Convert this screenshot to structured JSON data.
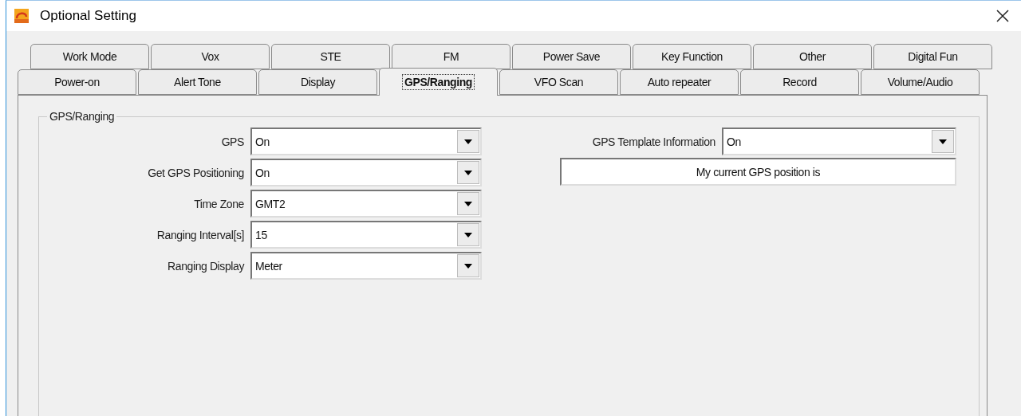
{
  "window": {
    "title": "Optional Setting"
  },
  "tab_rows": [
    [
      {
        "label": "Work Mode",
        "selected": false
      },
      {
        "label": "Vox",
        "selected": false
      },
      {
        "label": "STE",
        "selected": false
      },
      {
        "label": "FM",
        "selected": false
      },
      {
        "label": "Power Save",
        "selected": false
      },
      {
        "label": "Key Function",
        "selected": false
      },
      {
        "label": "Other",
        "selected": false
      },
      {
        "label": "Digital Fun",
        "selected": false
      }
    ],
    [
      {
        "label": "Power-on",
        "selected": false
      },
      {
        "label": "Alert Tone",
        "selected": false
      },
      {
        "label": "Display",
        "selected": false
      },
      {
        "label": "GPS/Ranging",
        "selected": true
      },
      {
        "label": "VFO Scan",
        "selected": false
      },
      {
        "label": "Auto repeater",
        "selected": false
      },
      {
        "label": "Record",
        "selected": false
      },
      {
        "label": "Volume/Audio",
        "selected": false
      }
    ]
  ],
  "group": {
    "title": "GPS/Ranging",
    "fields": [
      {
        "label": "GPS",
        "value": "On"
      },
      {
        "label": "Get GPS Positioning",
        "value": "On"
      },
      {
        "label": "Time Zone",
        "value": "GMT2"
      },
      {
        "label": "Ranging Interval[s]",
        "value": "15"
      },
      {
        "label": "Ranging Display",
        "value": "Meter"
      }
    ],
    "template": {
      "label": "GPS Template Information",
      "value": "On"
    },
    "message": {
      "value": "My current GPS position is"
    }
  }
}
